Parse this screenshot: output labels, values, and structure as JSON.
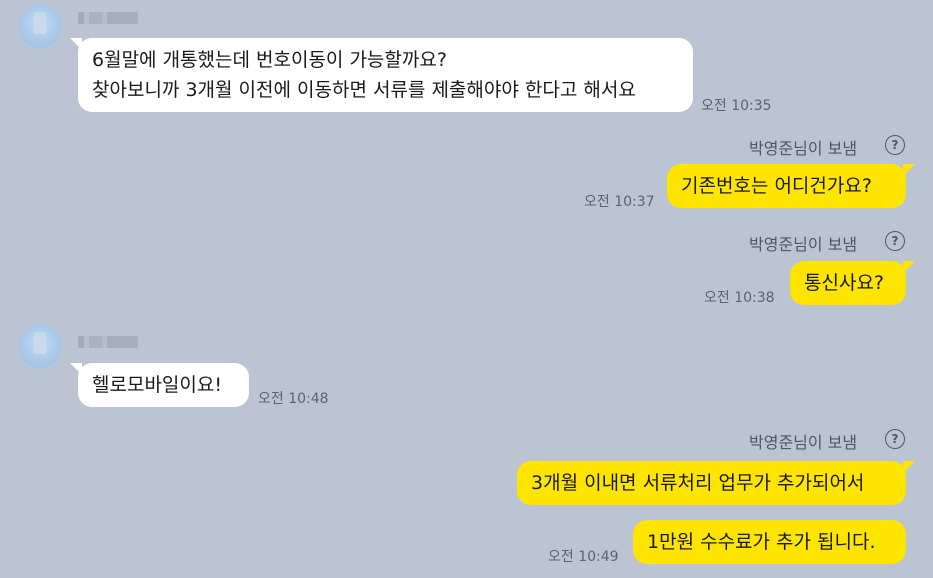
{
  "chat": {
    "incoming_1": {
      "lines": [
        "6월말에 개통했는데 번호이동이 가능할까요?",
        "찾아보니까 3개월 이전에 이동하면 서류를 제출해야야 한다고 해서요"
      ],
      "time": "오전 10:35"
    },
    "outgoing_1": {
      "status": "박영준님이 보냄",
      "help_glyph": "?",
      "text": "기존번호는 어디건가요?",
      "time": "오전 10:37"
    },
    "outgoing_2": {
      "status": "박영준님이 보냄",
      "help_glyph": "?",
      "text": "통신사요?",
      "time": "오전 10:38"
    },
    "incoming_2": {
      "text": "헬로모바일이요!",
      "time": "오전 10:48"
    },
    "outgoing_3": {
      "status": "박영준님이 보냄",
      "help_glyph": "?",
      "lines": [
        "3개월 이내면 서류처리 업무가 추가되어서",
        "1만원 수수료가 추가 됩니다."
      ],
      "time": "오전 10:49"
    }
  },
  "colors": {
    "background": "#bcc4d3",
    "incoming_bubble": "#ffffff",
    "outgoing_bubble": "#fee500",
    "timestamp": "#5c6270"
  },
  "icons": {
    "avatar": "avatar-placeholder",
    "help": "help-circle-icon"
  }
}
